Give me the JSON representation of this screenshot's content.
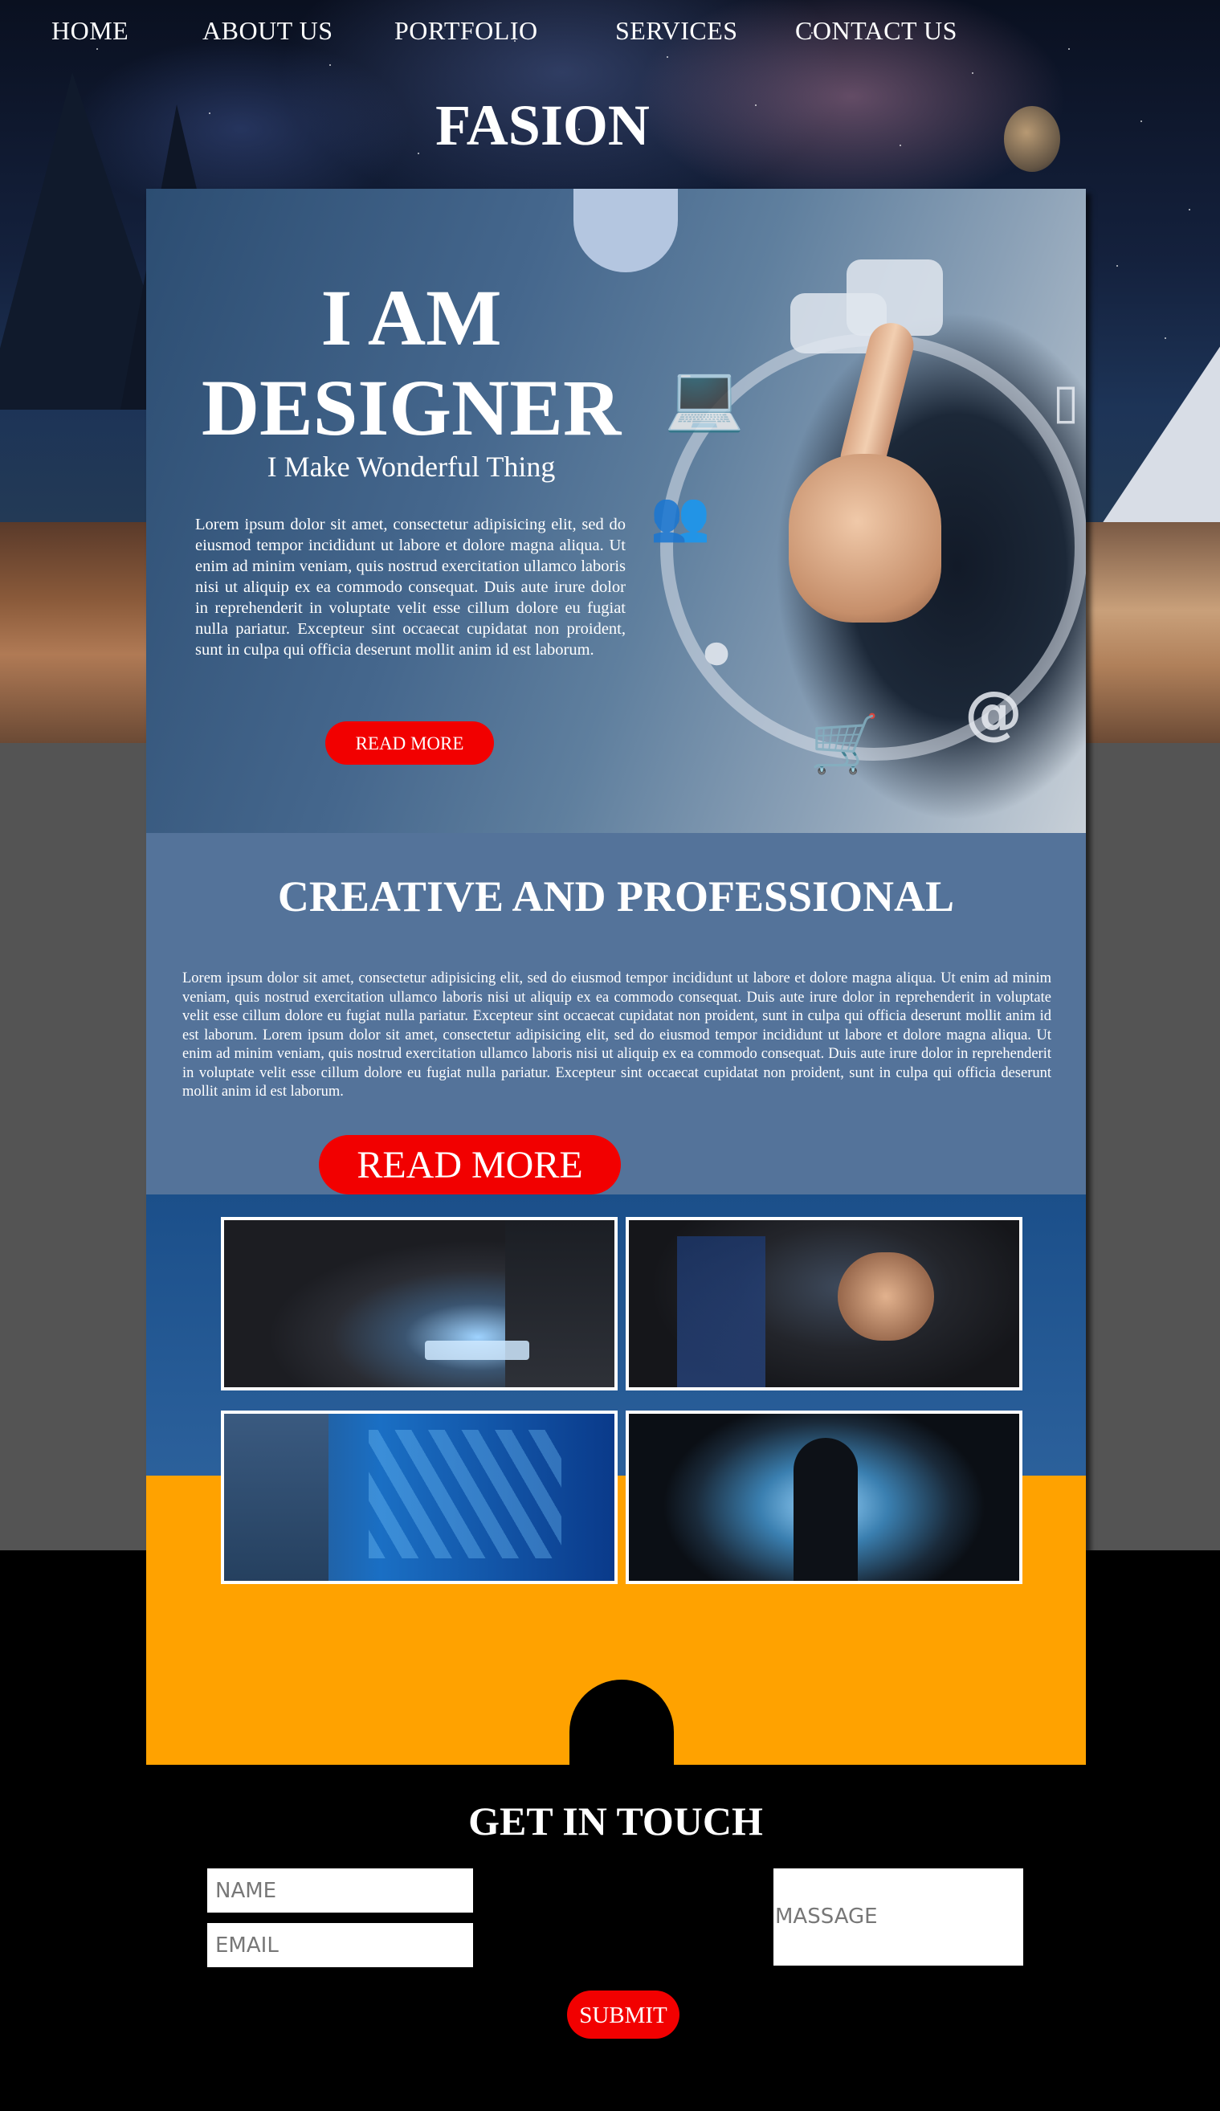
{
  "nav": {
    "items": [
      {
        "label": "HOME"
      },
      {
        "label": "ABOUT US"
      },
      {
        "label": "PORTFOLIO"
      },
      {
        "label": "SERVICES"
      },
      {
        "label": "CONTACT US"
      }
    ]
  },
  "brand": "FASION",
  "hero": {
    "title_line1": "I AM",
    "title_line2": "DESIGNER",
    "subtitle": "I Make Wonderful Thing",
    "body": "Lorem ipsum dolor sit amet, consectetur adipisicing elit, sed do eiusmod tempor incididunt ut labore et dolore magna aliqua. Ut enim ad minim veniam, quis nostrud exercitation ullamco laboris nisi ut aliquip ex ea commodo consequat. Duis aute irure dolor in reprehenderit in voluptate velit esse cillum dolore eu fugiat nulla pariatur. Excepteur sint occaecat cupidatat non proident, sunt in culpa qui officia deserunt mollit anim id est laborum.",
    "button": "READ MORE"
  },
  "creative": {
    "title": "CREATIVE AND PROFESSIONAL",
    "body": "Lorem ipsum dolor sit amet, consectetur adipisicing elit, sed do eiusmod tempor incididunt ut labore et dolore magna aliqua. Ut enim ad minim veniam, quis nostrud exercitation ullamco laboris nisi ut aliquip ex ea commodo consequat. Duis aute irure dolor in reprehenderit in voluptate velit esse cillum dolore eu fugiat nulla pariatur. Excepteur sint occaecat cupidatat non proident, sunt in culpa qui officia deserunt mollit anim id est laborum. Lorem ipsum dolor sit amet, consectetur adipisicing elit, sed do eiusmod tempor incididunt ut labore et dolore magna aliqua. Ut enim ad minim veniam, quis nostrud exercitation ullamco laboris nisi ut aliquip ex ea commodo consequat. Duis aute irure dolor in reprehenderit in voluptate velit esse cillum dolore eu fugiat nulla pariatur. Excepteur sint occaecat cupidatat non proident, sunt in culpa qui officia deserunt mollit anim id est laborum.",
    "button": "READ MORE"
  },
  "contact": {
    "title": "GET IN TOUCH",
    "name_placeholder": "NAME",
    "email_placeholder": "EMAIL",
    "message_placeholder": "MASSAGE",
    "submit": "SUBMIT"
  },
  "colors": {
    "accent_red": "#f20000",
    "orange": "#ffa200",
    "section_blue": "#54739a"
  }
}
